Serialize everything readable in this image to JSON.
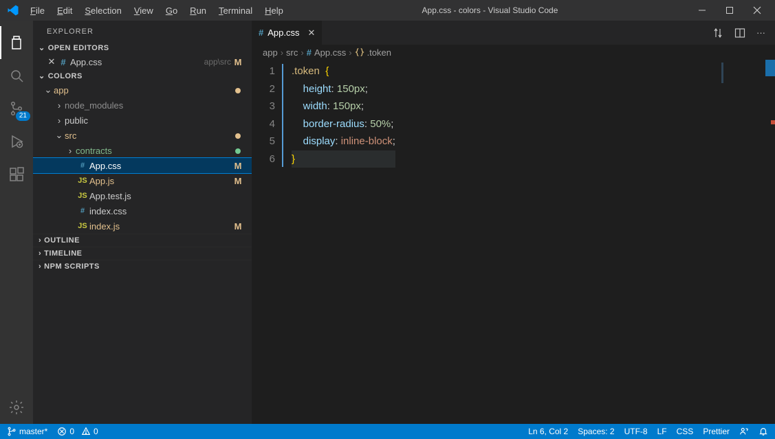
{
  "title": "App.css - colors - Visual Studio Code",
  "menubar": [
    "File",
    "Edit",
    "Selection",
    "View",
    "Go",
    "Run",
    "Terminal",
    "Help"
  ],
  "activity": {
    "scm_badge": "21"
  },
  "sidebar": {
    "title": "EXPLORER",
    "open_editors_label": "OPEN EDITORS",
    "open_editors": [
      {
        "name": "App.css",
        "path": "app\\src",
        "status": "M"
      }
    ],
    "workspace_label": "COLORS",
    "tree": {
      "app": "app",
      "node_modules": "node_modules",
      "public": "public",
      "src": "src",
      "contracts": "contracts",
      "files": [
        {
          "name": "App.css",
          "status": "M",
          "ico": "#",
          "col": "#519aba",
          "selected": true
        },
        {
          "name": "App.js",
          "status": "M",
          "ico": "JS",
          "col": "#cbcb41"
        },
        {
          "name": "App.test.js",
          "status": "",
          "ico": "JS",
          "col": "#cbcb41"
        },
        {
          "name": "index.css",
          "status": "",
          "ico": "#",
          "col": "#519aba"
        },
        {
          "name": "index.js",
          "status": "M",
          "ico": "JS",
          "col": "#cbcb41"
        }
      ]
    },
    "outline": "OUTLINE",
    "timeline": "TIMELINE",
    "npm_scripts": "NPM SCRIPTS"
  },
  "editor": {
    "tab_name": "App.css",
    "breadcrumbs": {
      "p1": "app",
      "p2": "src",
      "p3": "App.css",
      "p4": ".token"
    },
    "code": {
      "l1a": ".token",
      "l1b": " {",
      "l2p": "height",
      "l2v": "150px",
      "l3p": "width",
      "l3v": "150px",
      "l4p": "border-radius",
      "l4v": "50%",
      "l5p": "display",
      "l5v": "inline-block",
      "l6": "}"
    }
  },
  "status": {
    "branch": "master*",
    "errors": "0",
    "warnings": "0",
    "lncol": "Ln 6, Col 2",
    "spaces": "Spaces: 2",
    "encoding": "UTF-8",
    "eol": "LF",
    "lang": "CSS",
    "formatter": "Prettier"
  }
}
